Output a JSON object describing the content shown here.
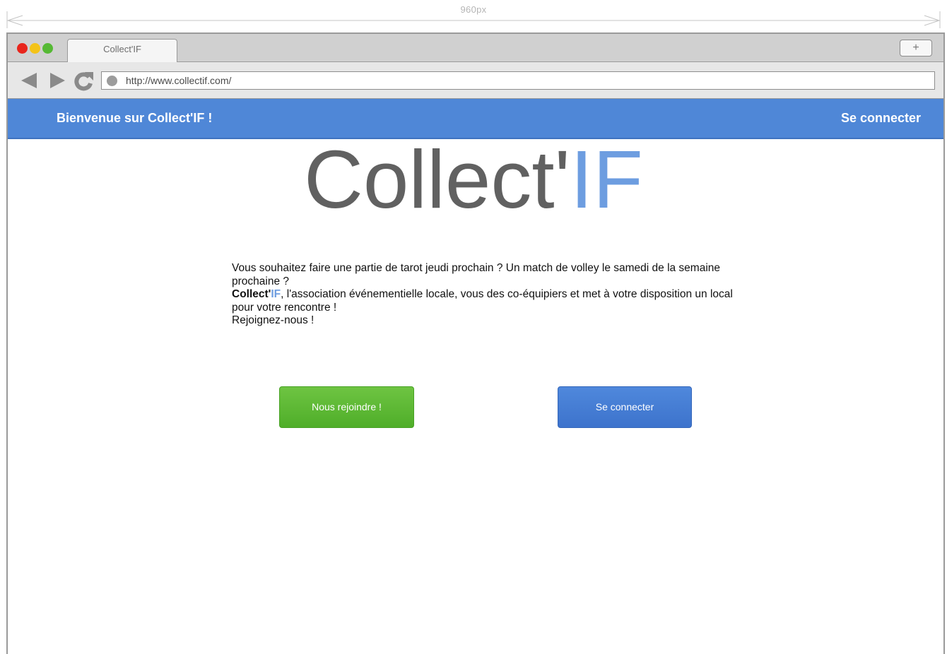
{
  "annotation": {
    "width_label": "960px"
  },
  "browser": {
    "tab_title": "Collect'IF",
    "new_tab_label": "+",
    "url": "http://www.collectif.com/"
  },
  "header": {
    "welcome": "Bienvenue sur Collect'IF !",
    "login_link": "Se connecter"
  },
  "logo": {
    "main": "Collect'",
    "accent": "IF"
  },
  "intro": {
    "line1": "Vous souhaitez faire une partie de tarot jeudi prochain ? Un match de volley le samedi de la semaine prochaine ?",
    "brand_main": "Collect'",
    "brand_accent": "IF",
    "line2": ", l'association événementielle locale, vous des co-équipiers et met à votre disposition un local pour votre rencontre !",
    "line3": "Rejoignez-nous !"
  },
  "actions": {
    "join_label": "Nous rejoindre !",
    "login_label": "Se connecter"
  },
  "colors": {
    "header_bg": "#4f87d7",
    "accent": "#6d9de0",
    "join_button": "#5cb833",
    "login_button": "#4680d6"
  }
}
